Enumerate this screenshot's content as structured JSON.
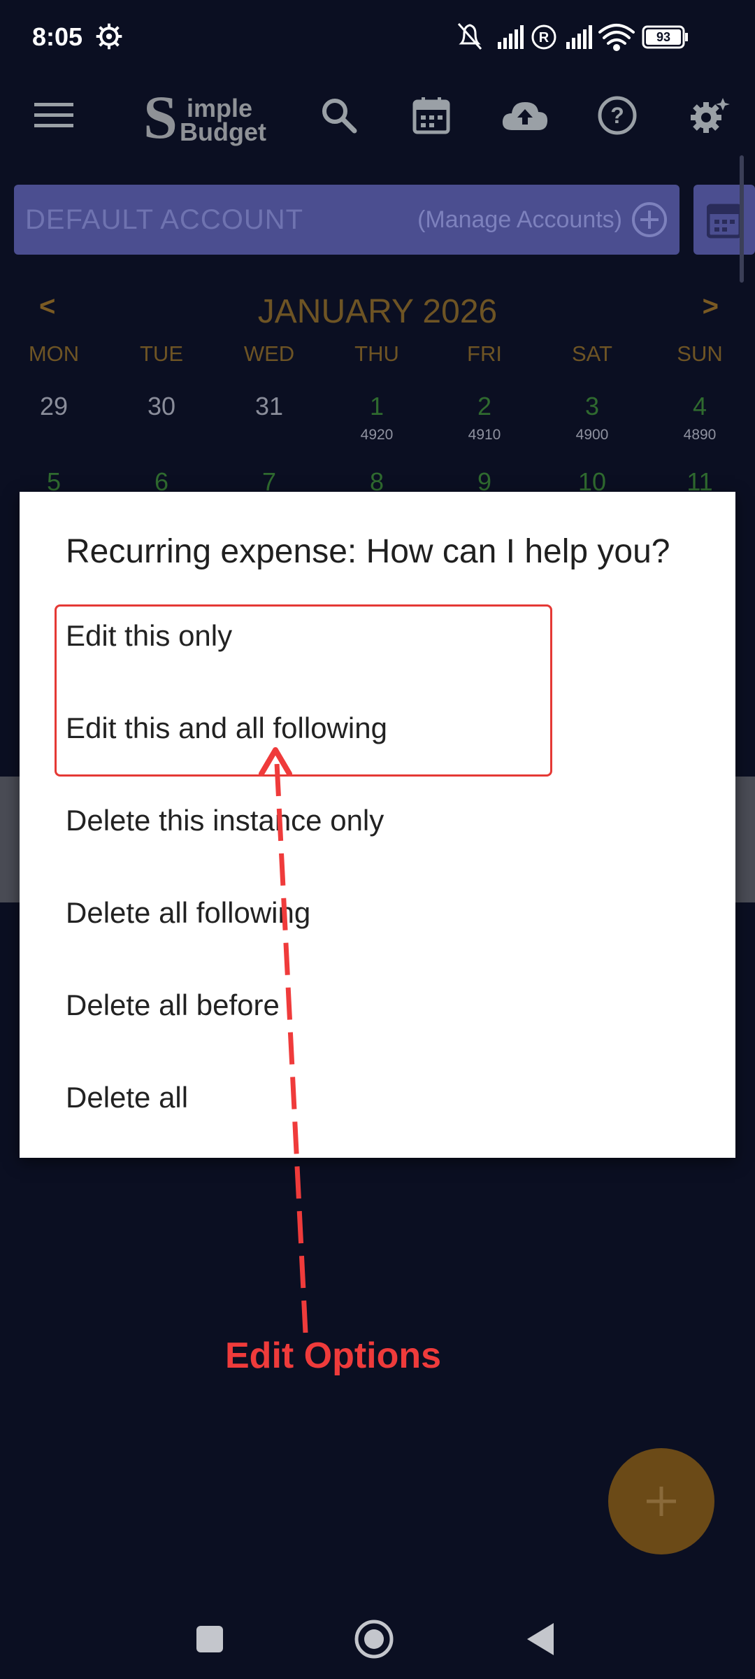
{
  "status_bar": {
    "time": "8:05",
    "battery": "93"
  },
  "app": {
    "logo_text": "Simple Budget",
    "account_name": "DEFAULT ACCOUNT",
    "manage_accounts": "(Manage Accounts)",
    "icons": [
      "menu-icon",
      "search-icon",
      "calendar-icon",
      "cloud-upload-icon",
      "help-icon",
      "settings-icon"
    ]
  },
  "calendar": {
    "prev": "<",
    "next": ">",
    "month": "JANUARY 2026",
    "weekdays": [
      "MON",
      "TUE",
      "WED",
      "THU",
      "FRI",
      "SAT",
      "SUN"
    ],
    "row1": [
      {
        "day": "29",
        "sub": ""
      },
      {
        "day": "30",
        "sub": ""
      },
      {
        "day": "31",
        "sub": ""
      },
      {
        "day": "1",
        "sub": "4920"
      },
      {
        "day": "2",
        "sub": "4910"
      },
      {
        "day": "3",
        "sub": "4900"
      },
      {
        "day": "4",
        "sub": "4890"
      }
    ],
    "row2": [
      "5",
      "6",
      "7",
      "8",
      "9",
      "10",
      "11"
    ]
  },
  "dialog": {
    "title": "Recurring expense: How can I help you?",
    "options": [
      "Edit this only",
      "Edit this and all following",
      "Delete this instance only",
      "Delete all following",
      "Delete all before",
      "Delete all"
    ]
  },
  "annotation": {
    "label": "Edit Options",
    "color": "#ef3b3b"
  },
  "fab": {
    "icon": "plus-icon"
  }
}
